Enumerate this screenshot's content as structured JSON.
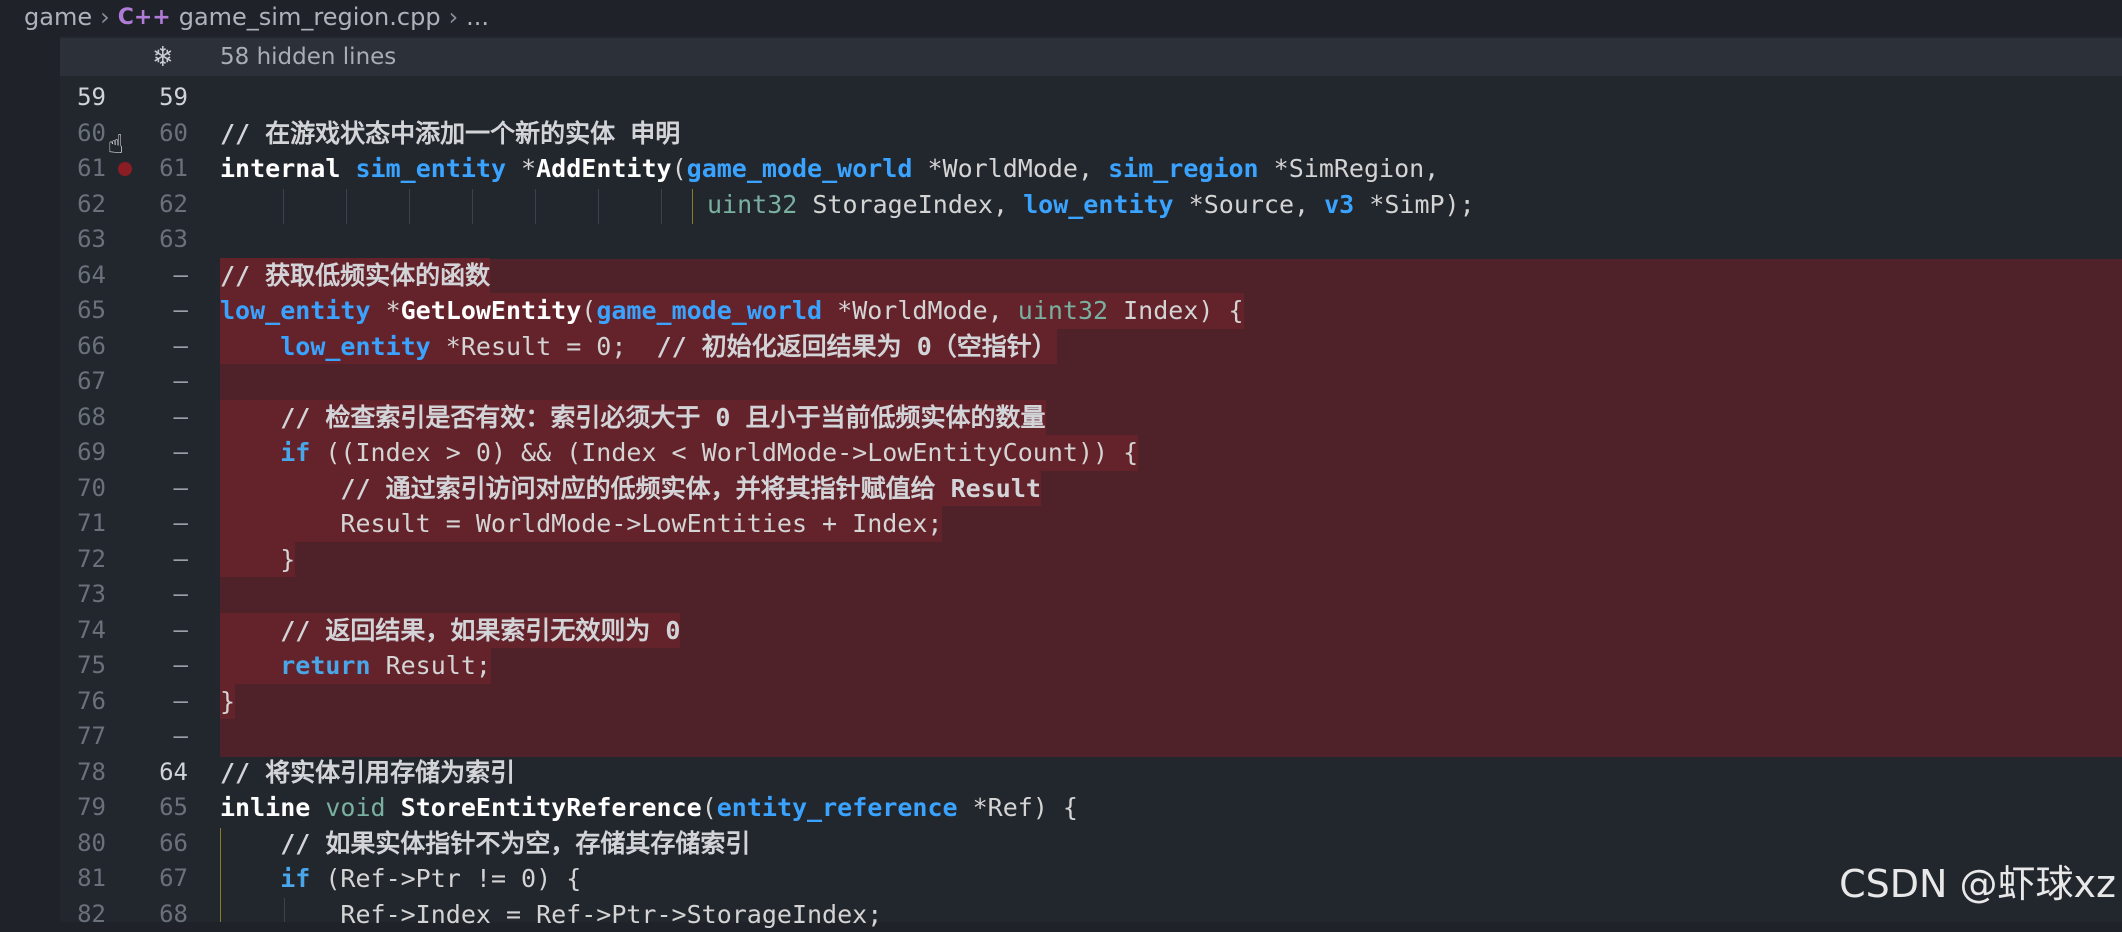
{
  "breadcrumb": {
    "folder": "game",
    "file": "game_sim_region.cpp",
    "more": "...",
    "file_icon": "C++"
  },
  "hidden": {
    "text": "58 hidden lines",
    "icon": "fold-icon"
  },
  "lines": [
    {
      "old": "59",
      "new": "59",
      "code": ""
    },
    {
      "old": "60",
      "new": "60",
      "code": "// 在游戏状态中添加一个新的实体 申明"
    },
    {
      "old": "61",
      "new": "61",
      "code": "internal sim_entity *AddEntity(game_mode_world *WorldMode, sim_region *SimRegion,"
    },
    {
      "old": "62",
      "new": "62",
      "code": "uint32 StorageIndex, low_entity *Source, v3 *SimP);"
    },
    {
      "old": "63",
      "new": "63",
      "code": ""
    },
    {
      "old": "64",
      "new": "—",
      "code": "// 获取低频实体的函数"
    },
    {
      "old": "65",
      "new": "—",
      "code": "low_entity *GetLowEntity(game_mode_world *WorldMode, uint32 Index) {"
    },
    {
      "old": "66",
      "new": "—",
      "code": "    low_entity *Result = 0;  // 初始化返回结果为 0（空指针）"
    },
    {
      "old": "67",
      "new": "—",
      "code": ""
    },
    {
      "old": "68",
      "new": "—",
      "code": "    // 检查索引是否有效：索引必须大于 0 且小于当前低频实体的数量"
    },
    {
      "old": "69",
      "new": "—",
      "code": "    if ((Index > 0) && (Index < WorldMode->LowEntityCount)) {"
    },
    {
      "old": "70",
      "new": "—",
      "code": "        // 通过索引访问对应的低频实体，并将其指针赋值给 Result"
    },
    {
      "old": "71",
      "new": "—",
      "code": "        Result = WorldMode->LowEntities + Index;"
    },
    {
      "old": "72",
      "new": "—",
      "code": "    }"
    },
    {
      "old": "73",
      "new": "—",
      "code": ""
    },
    {
      "old": "74",
      "new": "—",
      "code": "    // 返回结果，如果索引无效则为 0"
    },
    {
      "old": "75",
      "new": "—",
      "code": "    return Result;"
    },
    {
      "old": "76",
      "new": "—",
      "code": "}"
    },
    {
      "old": "77",
      "new": "—",
      "code": ""
    },
    {
      "old": "78",
      "new": "64",
      "code": "// 将实体引用存储为索引"
    },
    {
      "old": "79",
      "new": "65",
      "code": "inline void StoreEntityReference(entity_reference *Ref) {"
    },
    {
      "old": "80",
      "new": "66",
      "code": "    // 如果实体指针不为空，存储其存储索引"
    },
    {
      "old": "81",
      "new": "67",
      "code": "    if (Ref->Ptr != 0) {"
    },
    {
      "old": "82",
      "new": "68",
      "code": "        Ref->Index = Ref->Ptr->StorageIndex;"
    }
  ],
  "watermark": "CSDN @虾球xz"
}
